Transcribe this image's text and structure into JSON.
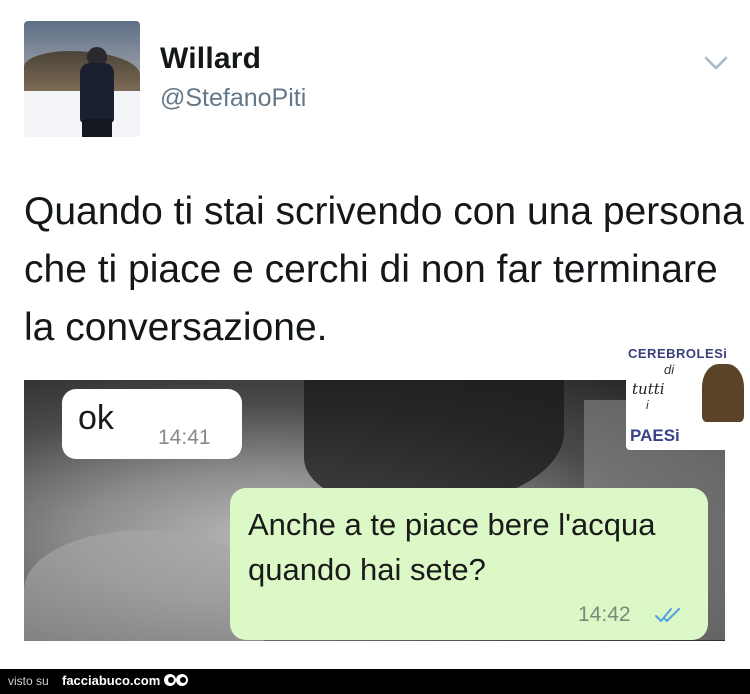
{
  "tweet": {
    "name": "Willard",
    "handle": "@StefanoPiti",
    "text": "Quando ti stai scrivendo con una persona che ti piace e cerchi di non far terminare la conversazione."
  },
  "icons": {
    "menu": "chevron-down-icon",
    "read_receipt": "double-check-icon",
    "footer_logo": "eyes-icon"
  },
  "chat": {
    "received": {
      "text": "ok",
      "time": "14:41"
    },
    "sent": {
      "text": "Anche a te piace bere l'acqua quando hai sete?",
      "time": "14:42"
    }
  },
  "watermark": {
    "line1": "CEREBROLESi",
    "line2": "di",
    "line3": "tutti",
    "line4": "i",
    "line5": "PAESi"
  },
  "footer": {
    "prefix": "visto su",
    "site": "facciabuco.com"
  },
  "colors": {
    "sent_bubble": "#dcf8c6",
    "received_bubble": "#ffffff",
    "handle_grey": "#657786",
    "read_tick_blue": "#4fa3e0"
  }
}
